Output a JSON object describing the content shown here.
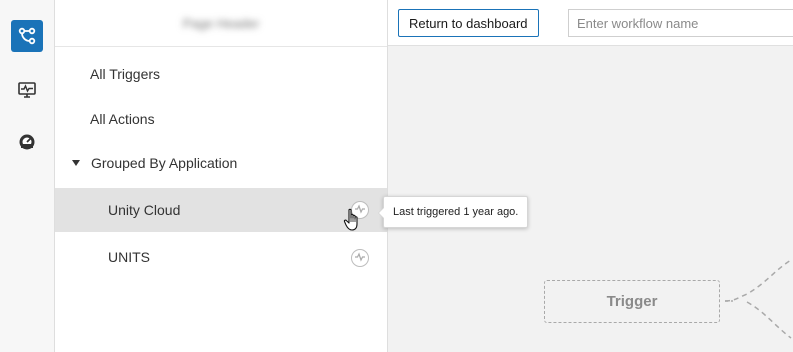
{
  "rail": {
    "items": [
      {
        "icon": "workflow-icon",
        "active": true
      },
      {
        "icon": "monitor-icon",
        "active": false
      },
      {
        "icon": "dashboard-gauge-icon",
        "active": false
      }
    ],
    "accent": "#1a73b8"
  },
  "panel": {
    "header_title": "Page Header",
    "items": [
      {
        "label": "All Triggers"
      },
      {
        "label": "All Actions"
      },
      {
        "label": "Grouped By Application"
      },
      {
        "label": "Unity Cloud"
      },
      {
        "label": "UNITS"
      }
    ]
  },
  "tooltip": {
    "text": "Last triggered 1 year ago."
  },
  "toolbar": {
    "return_label": "Return to dashboard",
    "workflow_placeholder": "Enter workflow name"
  },
  "canvas": {
    "trigger_label": "Trigger"
  }
}
